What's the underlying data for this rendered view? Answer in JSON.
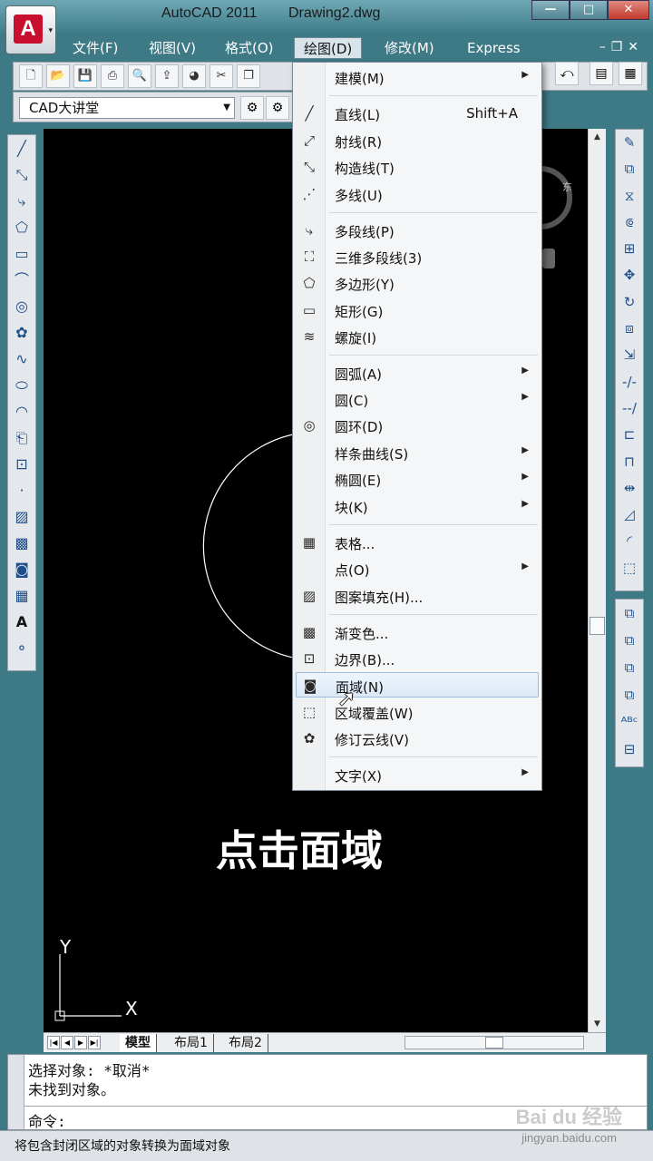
{
  "window": {
    "app_name": "AutoCAD 2011",
    "document": "Drawing2.dwg",
    "logo_letter": "A",
    "controls": {
      "minimize": "—",
      "maximize": "□",
      "close": "✕"
    }
  },
  "menubar": {
    "items": [
      "文件(F)",
      "视图(V)",
      "格式(O)",
      "绘图(D)",
      "修改(M)",
      "Express"
    ],
    "active": "绘图(D)",
    "mdi_controls": "–❐✕"
  },
  "toolbar": {
    "workspace_combo": "CAD大讲堂",
    "icons": [
      "new-icon",
      "open-icon",
      "save-icon",
      "print-icon",
      "preview-icon",
      "publish-icon",
      "3d-icon",
      "cut-icon",
      "copy-icon"
    ]
  },
  "draw_menu": {
    "items": [
      {
        "label": "建模(M)",
        "submenu": true
      },
      {
        "label": "直线(L)",
        "shortcut": "Shift+A"
      },
      {
        "label": "射线(R)"
      },
      {
        "label": "构造线(T)"
      },
      {
        "label": "多线(U)"
      },
      {
        "label": "多段线(P)"
      },
      {
        "label": "三维多段线(3)"
      },
      {
        "label": "多边形(Y)"
      },
      {
        "label": "矩形(G)"
      },
      {
        "label": "螺旋(I)"
      },
      {
        "label": "圆弧(A)",
        "submenu": true
      },
      {
        "label": "圆(C)",
        "submenu": true
      },
      {
        "label": "圆环(D)"
      },
      {
        "label": "样条曲线(S)",
        "submenu": true
      },
      {
        "label": "椭圆(E)",
        "submenu": true
      },
      {
        "label": "块(K)",
        "submenu": true
      },
      {
        "label": "表格..."
      },
      {
        "label": "点(O)",
        "submenu": true
      },
      {
        "label": "图案填充(H)..."
      },
      {
        "label": "渐变色..."
      },
      {
        "label": "边界(B)..."
      },
      {
        "label": "面域(N)",
        "highlighted": true
      },
      {
        "label": "区域覆盖(W)"
      },
      {
        "label": "修订云线(V)"
      },
      {
        "label": "文字(X)",
        "submenu": true
      }
    ]
  },
  "canvas": {
    "caption": "点击面域",
    "ucs_y": "Y",
    "ucs_x": "X",
    "viewcube_label": "东"
  },
  "tabs": [
    "模型",
    "布局1",
    "布局2"
  ],
  "active_tab": "模型",
  "command": {
    "history": [
      "选择对象: *取消*",
      "未找到对象。"
    ],
    "prompt": "命令:"
  },
  "status_text": "将包含封闭区域的对象转换为面域对象",
  "watermark": {
    "brand": "Bai du 经验",
    "url": "jingyan.baidu.com"
  }
}
